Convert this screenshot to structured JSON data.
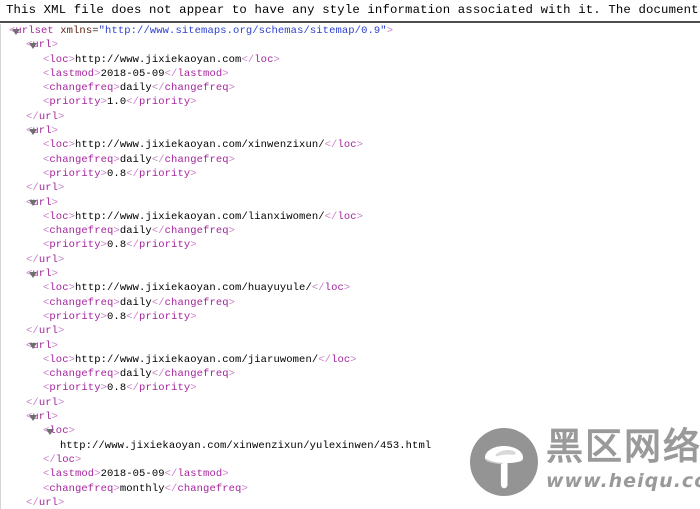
{
  "notice": {
    "text": "This XML file does not appear to have any style information associated with it. The document "
  },
  "watermark": {
    "logo_icon": "mushroom-icon",
    "brand_cn": "黑区网络",
    "brand_url": "www.heiqu.com",
    "color": "#9a9a9a"
  },
  "colors": {
    "tag": "#a6249e",
    "bracket": "#c77fc7",
    "attribute": "#5c2316",
    "attribute_value": "#2b3fd0",
    "text": "#000000",
    "twisty": "#6f6f6f",
    "rule": "#4d4d4d"
  },
  "xml": {
    "lines": [
      {
        "indent": 0,
        "twisty": true,
        "parts": [
          {
            "c": "brk",
            "t": "<"
          },
          {
            "c": "tag",
            "t": "urlset"
          },
          {
            "c": "txt",
            "t": " "
          },
          {
            "c": "attr",
            "t": "xmlns"
          },
          {
            "c": "eq",
            "t": "="
          },
          {
            "c": "val",
            "t": "\"http://www.sitemaps.org/schemas/sitemap/0.9\""
          },
          {
            "c": "brk",
            "t": ">"
          }
        ]
      },
      {
        "indent": 1,
        "twisty": true,
        "parts": [
          {
            "c": "brk",
            "t": "<"
          },
          {
            "c": "tag",
            "t": "url"
          },
          {
            "c": "brk",
            "t": ">"
          }
        ]
      },
      {
        "indent": 2,
        "twisty": false,
        "parts": [
          {
            "c": "brk",
            "t": "<"
          },
          {
            "c": "tag",
            "t": "loc"
          },
          {
            "c": "brk",
            "t": ">"
          },
          {
            "c": "txt",
            "t": "http://www.jixiekaoyan.com"
          },
          {
            "c": "brk",
            "t": "</"
          },
          {
            "c": "tag",
            "t": "loc"
          },
          {
            "c": "brk",
            "t": ">"
          }
        ]
      },
      {
        "indent": 2,
        "twisty": false,
        "parts": [
          {
            "c": "brk",
            "t": "<"
          },
          {
            "c": "tag",
            "t": "lastmod"
          },
          {
            "c": "brk",
            "t": ">"
          },
          {
            "c": "txt",
            "t": "2018-05-09"
          },
          {
            "c": "brk",
            "t": "</"
          },
          {
            "c": "tag",
            "t": "lastmod"
          },
          {
            "c": "brk",
            "t": ">"
          }
        ]
      },
      {
        "indent": 2,
        "twisty": false,
        "parts": [
          {
            "c": "brk",
            "t": "<"
          },
          {
            "c": "tag",
            "t": "changefreq"
          },
          {
            "c": "brk",
            "t": ">"
          },
          {
            "c": "txt",
            "t": "daily"
          },
          {
            "c": "brk",
            "t": "</"
          },
          {
            "c": "tag",
            "t": "changefreq"
          },
          {
            "c": "brk",
            "t": ">"
          }
        ]
      },
      {
        "indent": 2,
        "twisty": false,
        "parts": [
          {
            "c": "brk",
            "t": "<"
          },
          {
            "c": "tag",
            "t": "priority"
          },
          {
            "c": "brk",
            "t": ">"
          },
          {
            "c": "txt",
            "t": "1.0"
          },
          {
            "c": "brk",
            "t": "</"
          },
          {
            "c": "tag",
            "t": "priority"
          },
          {
            "c": "brk",
            "t": ">"
          }
        ]
      },
      {
        "indent": 1,
        "twisty": false,
        "parts": [
          {
            "c": "brk",
            "t": "</"
          },
          {
            "c": "tag",
            "t": "url"
          },
          {
            "c": "brk",
            "t": ">"
          }
        ]
      },
      {
        "indent": 1,
        "twisty": true,
        "parts": [
          {
            "c": "brk",
            "t": "<"
          },
          {
            "c": "tag",
            "t": "url"
          },
          {
            "c": "brk",
            "t": ">"
          }
        ]
      },
      {
        "indent": 2,
        "twisty": false,
        "parts": [
          {
            "c": "brk",
            "t": "<"
          },
          {
            "c": "tag",
            "t": "loc"
          },
          {
            "c": "brk",
            "t": ">"
          },
          {
            "c": "txt",
            "t": "http://www.jixiekaoyan.com/xinwenzixun/"
          },
          {
            "c": "brk",
            "t": "</"
          },
          {
            "c": "tag",
            "t": "loc"
          },
          {
            "c": "brk",
            "t": ">"
          }
        ]
      },
      {
        "indent": 2,
        "twisty": false,
        "parts": [
          {
            "c": "brk",
            "t": "<"
          },
          {
            "c": "tag",
            "t": "changefreq"
          },
          {
            "c": "brk",
            "t": ">"
          },
          {
            "c": "txt",
            "t": "daily"
          },
          {
            "c": "brk",
            "t": "</"
          },
          {
            "c": "tag",
            "t": "changefreq"
          },
          {
            "c": "brk",
            "t": ">"
          }
        ]
      },
      {
        "indent": 2,
        "twisty": false,
        "parts": [
          {
            "c": "brk",
            "t": "<"
          },
          {
            "c": "tag",
            "t": "priority"
          },
          {
            "c": "brk",
            "t": ">"
          },
          {
            "c": "txt",
            "t": "0.8"
          },
          {
            "c": "brk",
            "t": "</"
          },
          {
            "c": "tag",
            "t": "priority"
          },
          {
            "c": "brk",
            "t": ">"
          }
        ]
      },
      {
        "indent": 1,
        "twisty": false,
        "parts": [
          {
            "c": "brk",
            "t": "</"
          },
          {
            "c": "tag",
            "t": "url"
          },
          {
            "c": "brk",
            "t": ">"
          }
        ]
      },
      {
        "indent": 1,
        "twisty": true,
        "parts": [
          {
            "c": "brk",
            "t": "<"
          },
          {
            "c": "tag",
            "t": "url"
          },
          {
            "c": "brk",
            "t": ">"
          }
        ]
      },
      {
        "indent": 2,
        "twisty": false,
        "parts": [
          {
            "c": "brk",
            "t": "<"
          },
          {
            "c": "tag",
            "t": "loc"
          },
          {
            "c": "brk",
            "t": ">"
          },
          {
            "c": "txt",
            "t": "http://www.jixiekaoyan.com/lianxiwomen/"
          },
          {
            "c": "brk",
            "t": "</"
          },
          {
            "c": "tag",
            "t": "loc"
          },
          {
            "c": "brk",
            "t": ">"
          }
        ]
      },
      {
        "indent": 2,
        "twisty": false,
        "parts": [
          {
            "c": "brk",
            "t": "<"
          },
          {
            "c": "tag",
            "t": "changefreq"
          },
          {
            "c": "brk",
            "t": ">"
          },
          {
            "c": "txt",
            "t": "daily"
          },
          {
            "c": "brk",
            "t": "</"
          },
          {
            "c": "tag",
            "t": "changefreq"
          },
          {
            "c": "brk",
            "t": ">"
          }
        ]
      },
      {
        "indent": 2,
        "twisty": false,
        "parts": [
          {
            "c": "brk",
            "t": "<"
          },
          {
            "c": "tag",
            "t": "priority"
          },
          {
            "c": "brk",
            "t": ">"
          },
          {
            "c": "txt",
            "t": "0.8"
          },
          {
            "c": "brk",
            "t": "</"
          },
          {
            "c": "tag",
            "t": "priority"
          },
          {
            "c": "brk",
            "t": ">"
          }
        ]
      },
      {
        "indent": 1,
        "twisty": false,
        "parts": [
          {
            "c": "brk",
            "t": "</"
          },
          {
            "c": "tag",
            "t": "url"
          },
          {
            "c": "brk",
            "t": ">"
          }
        ]
      },
      {
        "indent": 1,
        "twisty": true,
        "parts": [
          {
            "c": "brk",
            "t": "<"
          },
          {
            "c": "tag",
            "t": "url"
          },
          {
            "c": "brk",
            "t": ">"
          }
        ]
      },
      {
        "indent": 2,
        "twisty": false,
        "parts": [
          {
            "c": "brk",
            "t": "<"
          },
          {
            "c": "tag",
            "t": "loc"
          },
          {
            "c": "brk",
            "t": ">"
          },
          {
            "c": "txt",
            "t": "http://www.jixiekaoyan.com/huayuyule/"
          },
          {
            "c": "brk",
            "t": "</"
          },
          {
            "c": "tag",
            "t": "loc"
          },
          {
            "c": "brk",
            "t": ">"
          }
        ]
      },
      {
        "indent": 2,
        "twisty": false,
        "parts": [
          {
            "c": "brk",
            "t": "<"
          },
          {
            "c": "tag",
            "t": "changefreq"
          },
          {
            "c": "brk",
            "t": ">"
          },
          {
            "c": "txt",
            "t": "daily"
          },
          {
            "c": "brk",
            "t": "</"
          },
          {
            "c": "tag",
            "t": "changefreq"
          },
          {
            "c": "brk",
            "t": ">"
          }
        ]
      },
      {
        "indent": 2,
        "twisty": false,
        "parts": [
          {
            "c": "brk",
            "t": "<"
          },
          {
            "c": "tag",
            "t": "priority"
          },
          {
            "c": "brk",
            "t": ">"
          },
          {
            "c": "txt",
            "t": "0.8"
          },
          {
            "c": "brk",
            "t": "</"
          },
          {
            "c": "tag",
            "t": "priority"
          },
          {
            "c": "brk",
            "t": ">"
          }
        ]
      },
      {
        "indent": 1,
        "twisty": false,
        "parts": [
          {
            "c": "brk",
            "t": "</"
          },
          {
            "c": "tag",
            "t": "url"
          },
          {
            "c": "brk",
            "t": ">"
          }
        ]
      },
      {
        "indent": 1,
        "twisty": true,
        "parts": [
          {
            "c": "brk",
            "t": "<"
          },
          {
            "c": "tag",
            "t": "url"
          },
          {
            "c": "brk",
            "t": ">"
          }
        ]
      },
      {
        "indent": 2,
        "twisty": false,
        "parts": [
          {
            "c": "brk",
            "t": "<"
          },
          {
            "c": "tag",
            "t": "loc"
          },
          {
            "c": "brk",
            "t": ">"
          },
          {
            "c": "txt",
            "t": "http://www.jixiekaoyan.com/jiaruwomen/"
          },
          {
            "c": "brk",
            "t": "</"
          },
          {
            "c": "tag",
            "t": "loc"
          },
          {
            "c": "brk",
            "t": ">"
          }
        ]
      },
      {
        "indent": 2,
        "twisty": false,
        "parts": [
          {
            "c": "brk",
            "t": "<"
          },
          {
            "c": "tag",
            "t": "changefreq"
          },
          {
            "c": "brk",
            "t": ">"
          },
          {
            "c": "txt",
            "t": "daily"
          },
          {
            "c": "brk",
            "t": "</"
          },
          {
            "c": "tag",
            "t": "changefreq"
          },
          {
            "c": "brk",
            "t": ">"
          }
        ]
      },
      {
        "indent": 2,
        "twisty": false,
        "parts": [
          {
            "c": "brk",
            "t": "<"
          },
          {
            "c": "tag",
            "t": "priority"
          },
          {
            "c": "brk",
            "t": ">"
          },
          {
            "c": "txt",
            "t": "0.8"
          },
          {
            "c": "brk",
            "t": "</"
          },
          {
            "c": "tag",
            "t": "priority"
          },
          {
            "c": "brk",
            "t": ">"
          }
        ]
      },
      {
        "indent": 1,
        "twisty": false,
        "parts": [
          {
            "c": "brk",
            "t": "</"
          },
          {
            "c": "tag",
            "t": "url"
          },
          {
            "c": "brk",
            "t": ">"
          }
        ]
      },
      {
        "indent": 1,
        "twisty": true,
        "parts": [
          {
            "c": "brk",
            "t": "<"
          },
          {
            "c": "tag",
            "t": "url"
          },
          {
            "c": "brk",
            "t": ">"
          }
        ]
      },
      {
        "indent": 2,
        "twisty": true,
        "parts": [
          {
            "c": "brk",
            "t": "<"
          },
          {
            "c": "tag",
            "t": "loc"
          },
          {
            "c": "brk",
            "t": ">"
          }
        ]
      },
      {
        "indent": 3,
        "twisty": false,
        "parts": [
          {
            "c": "txt",
            "t": "http://www.jixiekaoyan.com/xinwenzixun/yulexinwen/453.html"
          }
        ]
      },
      {
        "indent": 2,
        "twisty": false,
        "parts": [
          {
            "c": "brk",
            "t": "</"
          },
          {
            "c": "tag",
            "t": "loc"
          },
          {
            "c": "brk",
            "t": ">"
          }
        ]
      },
      {
        "indent": 2,
        "twisty": false,
        "parts": [
          {
            "c": "brk",
            "t": "<"
          },
          {
            "c": "tag",
            "t": "lastmod"
          },
          {
            "c": "brk",
            "t": ">"
          },
          {
            "c": "txt",
            "t": "2018-05-09"
          },
          {
            "c": "brk",
            "t": "</"
          },
          {
            "c": "tag",
            "t": "lastmod"
          },
          {
            "c": "brk",
            "t": ">"
          }
        ]
      },
      {
        "indent": 2,
        "twisty": false,
        "parts": [
          {
            "c": "brk",
            "t": "<"
          },
          {
            "c": "tag",
            "t": "changefreq"
          },
          {
            "c": "brk",
            "t": ">"
          },
          {
            "c": "txt",
            "t": "monthly"
          },
          {
            "c": "brk",
            "t": "</"
          },
          {
            "c": "tag",
            "t": "changefreq"
          },
          {
            "c": "brk",
            "t": ">"
          }
        ]
      },
      {
        "indent": 1,
        "twisty": false,
        "parts": [
          {
            "c": "brk",
            "t": "</"
          },
          {
            "c": "tag",
            "t": "url"
          },
          {
            "c": "brk",
            "t": ">"
          }
        ]
      }
    ]
  }
}
